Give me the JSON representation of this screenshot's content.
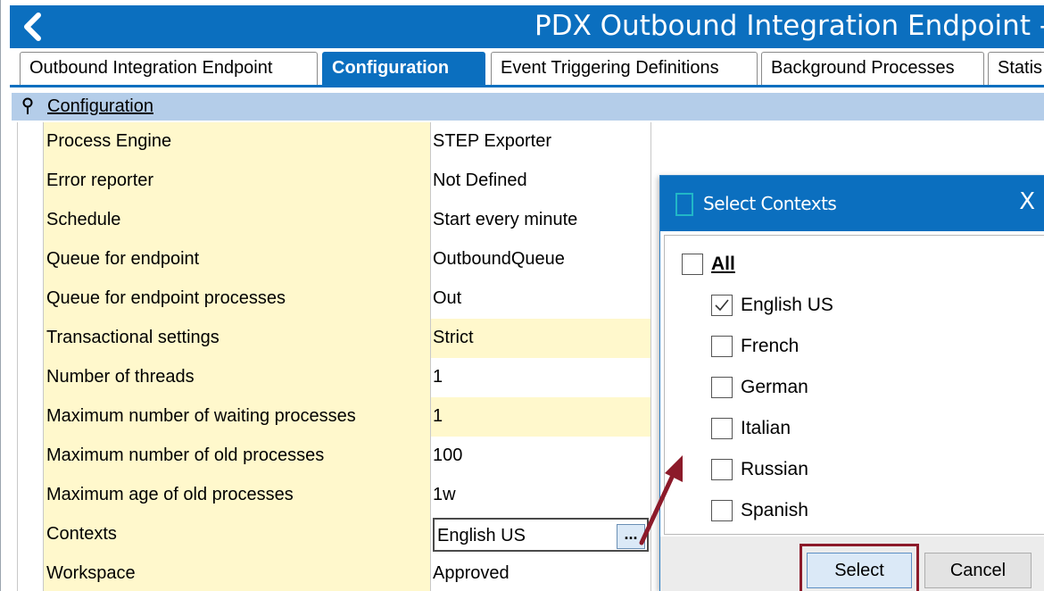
{
  "window": {
    "title": "PDX Outbound Integration Endpoint - C"
  },
  "tabs": [
    {
      "label": "Outbound Integration Endpoint",
      "active": false
    },
    {
      "label": "Configuration",
      "active": true
    },
    {
      "label": "Event Triggering Definitions",
      "active": false
    },
    {
      "label": "Background Processes",
      "active": false
    },
    {
      "label": "Statis",
      "active": false
    }
  ],
  "section": {
    "title": "Configuration",
    "icon": "pin-icon"
  },
  "rows": [
    {
      "label": "Process Engine",
      "value": "STEP Exporter"
    },
    {
      "label": "Error reporter",
      "value": "Not Defined"
    },
    {
      "label": "Schedule",
      "value": "Start every minute"
    },
    {
      "label": "Queue for endpoint",
      "value": "OutboundQueue"
    },
    {
      "label": "Queue for endpoint processes",
      "value": "Out"
    },
    {
      "label": "Transactional settings",
      "value": "Strict"
    },
    {
      "label": "Number of threads",
      "value": "1"
    },
    {
      "label": "Maximum number of waiting processes",
      "value": "1"
    },
    {
      "label": "Maximum number of old processes",
      "value": "100"
    },
    {
      "label": "Maximum age of old processes",
      "value": "1w"
    },
    {
      "label": "Contexts",
      "value": "English US",
      "browse_label": "..."
    },
    {
      "label": "Workspace",
      "value": "Approved"
    }
  ],
  "dialog": {
    "title": "Select Contexts",
    "close_label": "X",
    "options": [
      {
        "label": "All",
        "checked": false
      },
      {
        "label": "English US",
        "checked": true
      },
      {
        "label": "French",
        "checked": false
      },
      {
        "label": "German",
        "checked": false
      },
      {
        "label": "Italian",
        "checked": false
      },
      {
        "label": "Russian",
        "checked": false
      },
      {
        "label": "Spanish",
        "checked": false
      }
    ],
    "select_label": "Select",
    "cancel_label": "Cancel"
  },
  "colors": {
    "titlebar": "#0b6fbf",
    "section_header": "#b4cde9",
    "label_cell": "#fff8cc",
    "highlight": "#8c1a2a",
    "select_button": "#dbe9f7"
  }
}
